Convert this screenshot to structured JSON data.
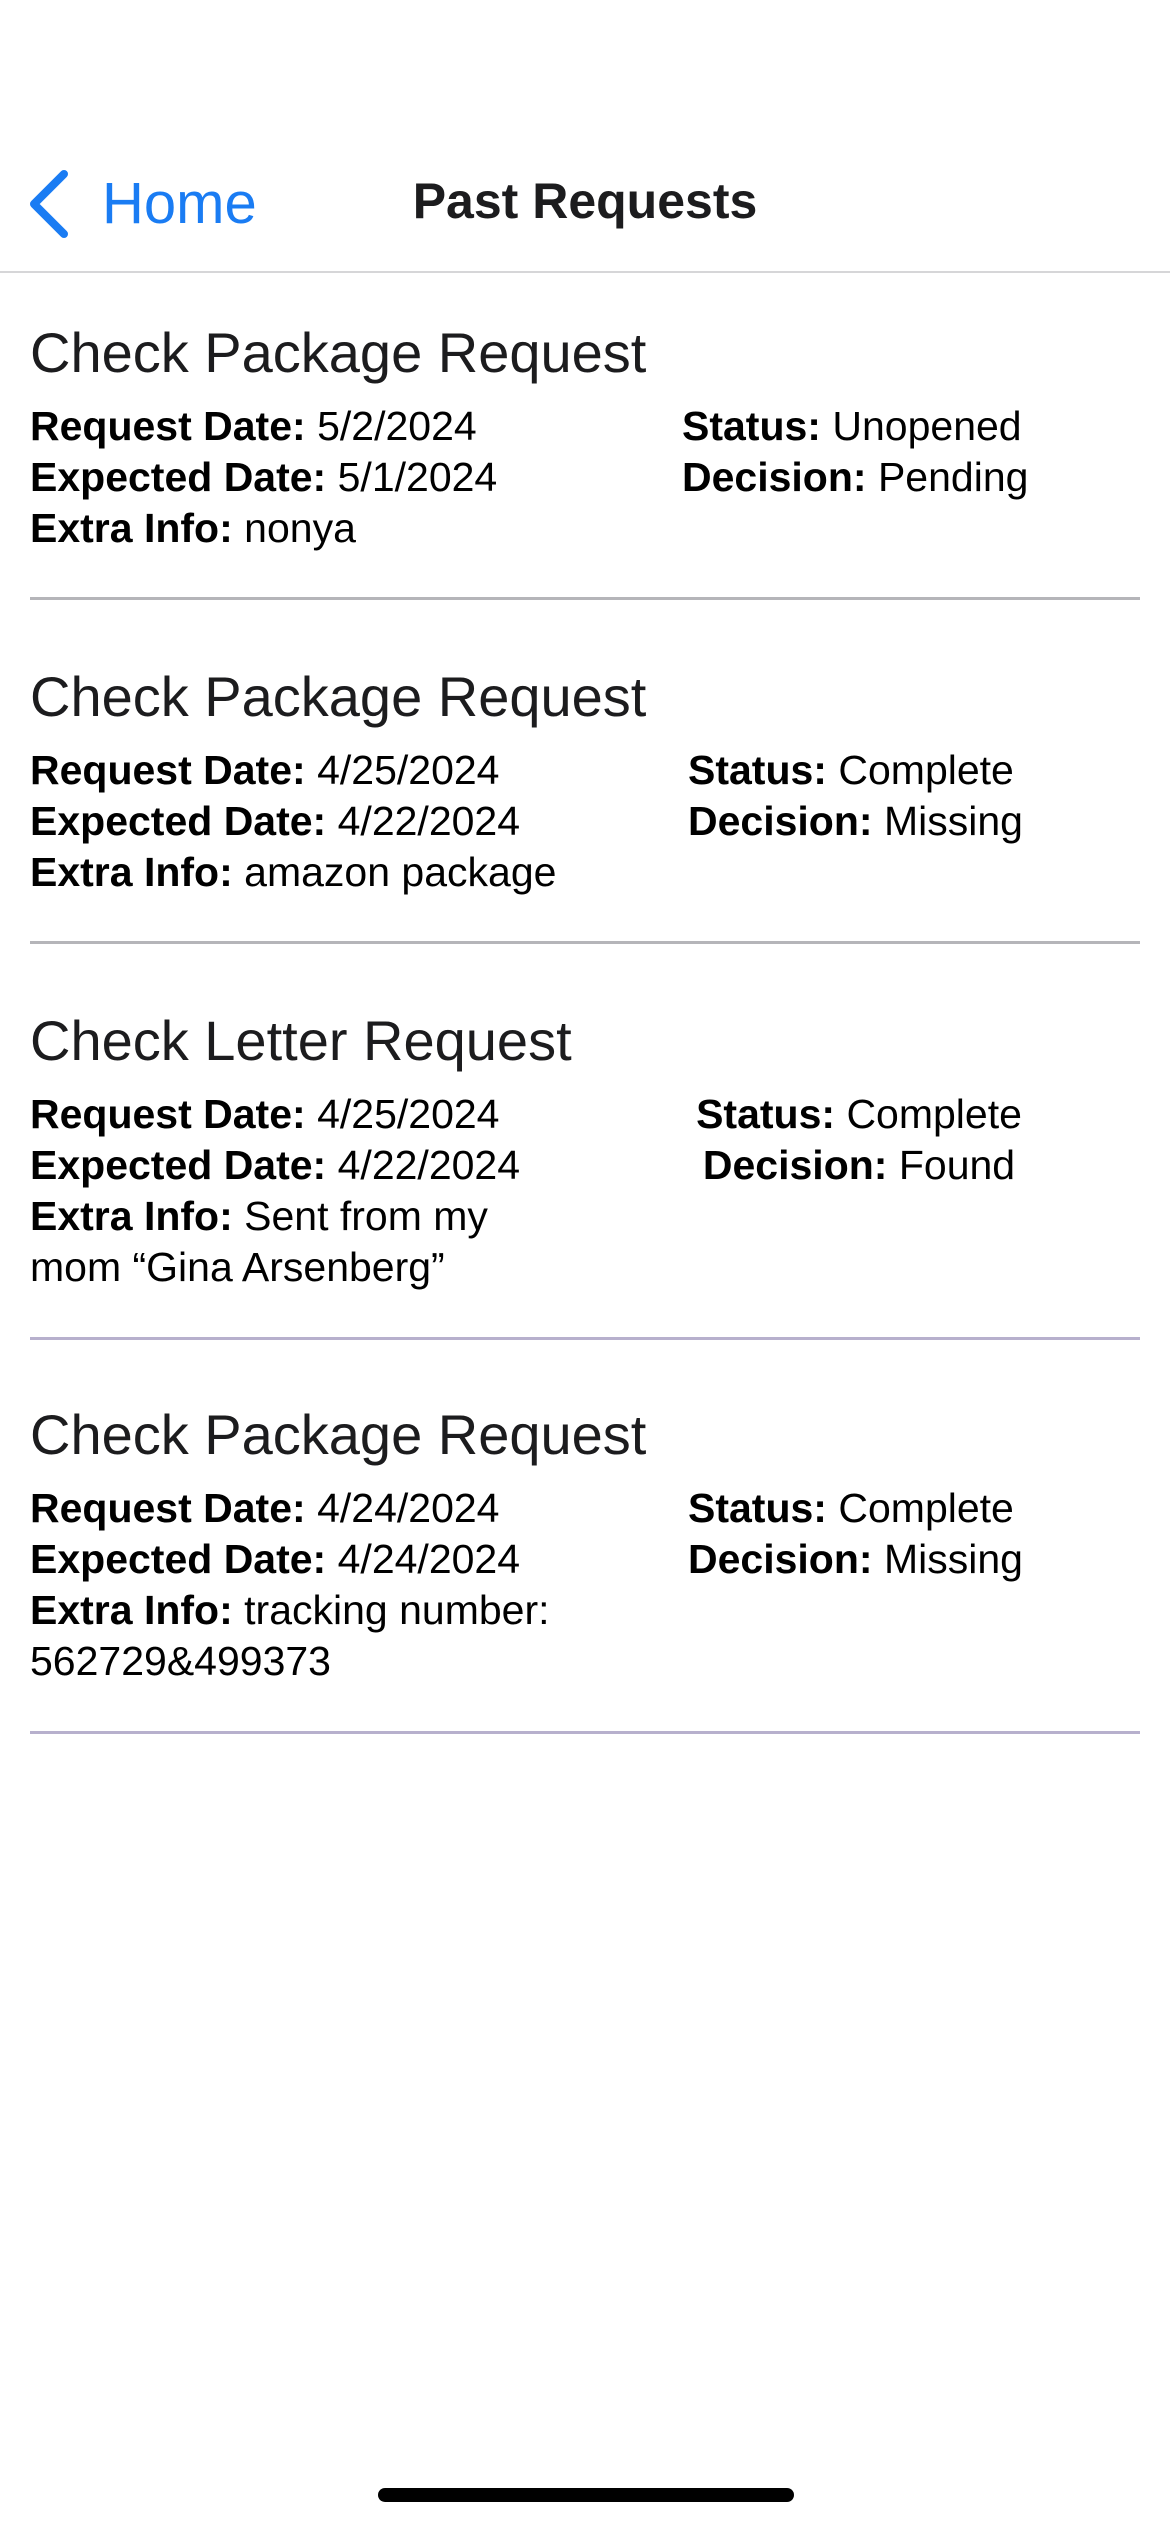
{
  "nav": {
    "back_label": "Home",
    "title": "Past Requests",
    "back_icon": "chevron-left-icon",
    "accent_color": "#1a7cf3"
  },
  "labels": {
    "request_date": "Request Date:",
    "expected_date": "Expected Date:",
    "extra_info": "Extra Info:",
    "status": "Status:",
    "decision": "Decision:"
  },
  "requests": [
    {
      "title": "Check Package Request",
      "request_date": "5/2/2024",
      "expected_date": "5/1/2024",
      "extra_info": "nonya",
      "status": "Unopened",
      "decision": "Pending"
    },
    {
      "title": "Check Package Request",
      "request_date": "4/25/2024",
      "expected_date": "4/22/2024",
      "extra_info": "amazon package",
      "status": "Complete",
      "decision": "Missing"
    },
    {
      "title": "Check Letter Request",
      "request_date": "4/25/2024",
      "expected_date": "4/22/2024",
      "extra_info": "Sent from my mom “Gina Arsenberg”",
      "status": "Complete",
      "decision": "Found"
    },
    {
      "title": "Check Package Request",
      "request_date": "4/24/2024",
      "expected_date": "4/24/2024",
      "extra_info": "tracking number: 562729&499373",
      "status": "Complete",
      "decision": "Missing"
    }
  ]
}
